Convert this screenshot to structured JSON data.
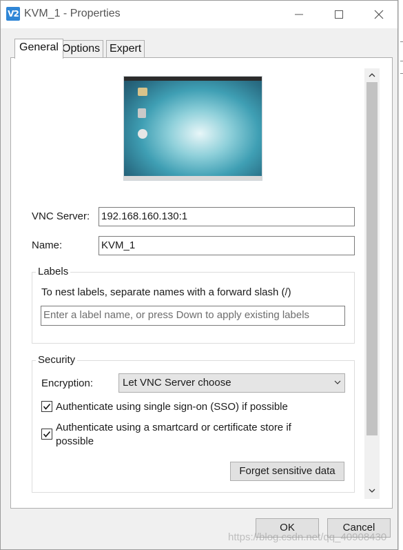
{
  "window": {
    "title": "KVM_1 - Properties",
    "app_icon_text": "V2"
  },
  "tabs": [
    {
      "label": "General",
      "active": true
    },
    {
      "label": "Options",
      "active": false
    },
    {
      "label": "Expert",
      "active": false
    }
  ],
  "general": {
    "vnc_server_label": "VNC Server:",
    "vnc_server_value": "192.168.160.130:1",
    "name_label": "Name:",
    "name_value": "KVM_1",
    "labels": {
      "title": "Labels",
      "hint": "To nest labels, separate names with a forward slash (/)",
      "placeholder": "Enter a label name, or press Down to apply existing labels"
    },
    "security": {
      "title": "Security",
      "encryption_label": "Encryption:",
      "encryption_value": "Let VNC Server choose",
      "sso_label": "Authenticate using single sign-on (SSO) if possible",
      "sso_checked": true,
      "smartcard_label_line1": "Authenticate using a smartcard or certificate store if",
      "smartcard_label_line2": "possible",
      "smartcard_checked": true,
      "forget_button": "Forget sensitive data"
    }
  },
  "footer": {
    "ok_label": "OK",
    "cancel_label": "Cancel"
  },
  "watermark": "https://blog.csdn.net/qq_40908430",
  "colors": {
    "accent": "#2f86d6",
    "window_bg": "#f0f0f0",
    "panel_bg": "#ffffff"
  }
}
